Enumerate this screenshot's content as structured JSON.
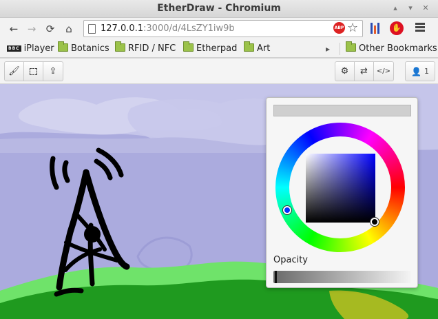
{
  "window": {
    "title": "EtherDraw - Chromium",
    "controls": [
      "▴",
      "▾",
      "✕"
    ]
  },
  "nav": {
    "back_icon": "←",
    "forward_icon": "→",
    "reload_icon": "⟳",
    "home_icon": "⌂"
  },
  "address": {
    "host": "127.0.0.1",
    "path": ":3000/d/4LsZY1iw9b"
  },
  "extensions": {
    "abp_label": "ABP",
    "star_icon": "☆",
    "blocker_icon": "✋"
  },
  "bookmarks": {
    "items": [
      {
        "label": "iPlayer",
        "icon": "bbc-icon",
        "badge": "BBC"
      },
      {
        "label": "Botanics",
        "icon": "folder-icon"
      },
      {
        "label": "RFID / NFC",
        "icon": "folder-icon"
      },
      {
        "label": "Etherpad",
        "icon": "folder-icon"
      },
      {
        "label": "Art",
        "icon": "folder-icon"
      }
    ],
    "overflow_icon": "▸",
    "other": "Other Bookmarks"
  },
  "app_toolbar": {
    "brush_icon": "🖌",
    "upload_icon": "⇪",
    "settings_icon": "⚙",
    "swap_icon": "⇄",
    "embed_icon": "</>",
    "user_icon": "👤",
    "user_count": "1"
  },
  "picker": {
    "opacity_label": "Opacity",
    "current_color": "#000000",
    "swatch_color": "#cfcfcf",
    "opacity_value": 0.0
  }
}
